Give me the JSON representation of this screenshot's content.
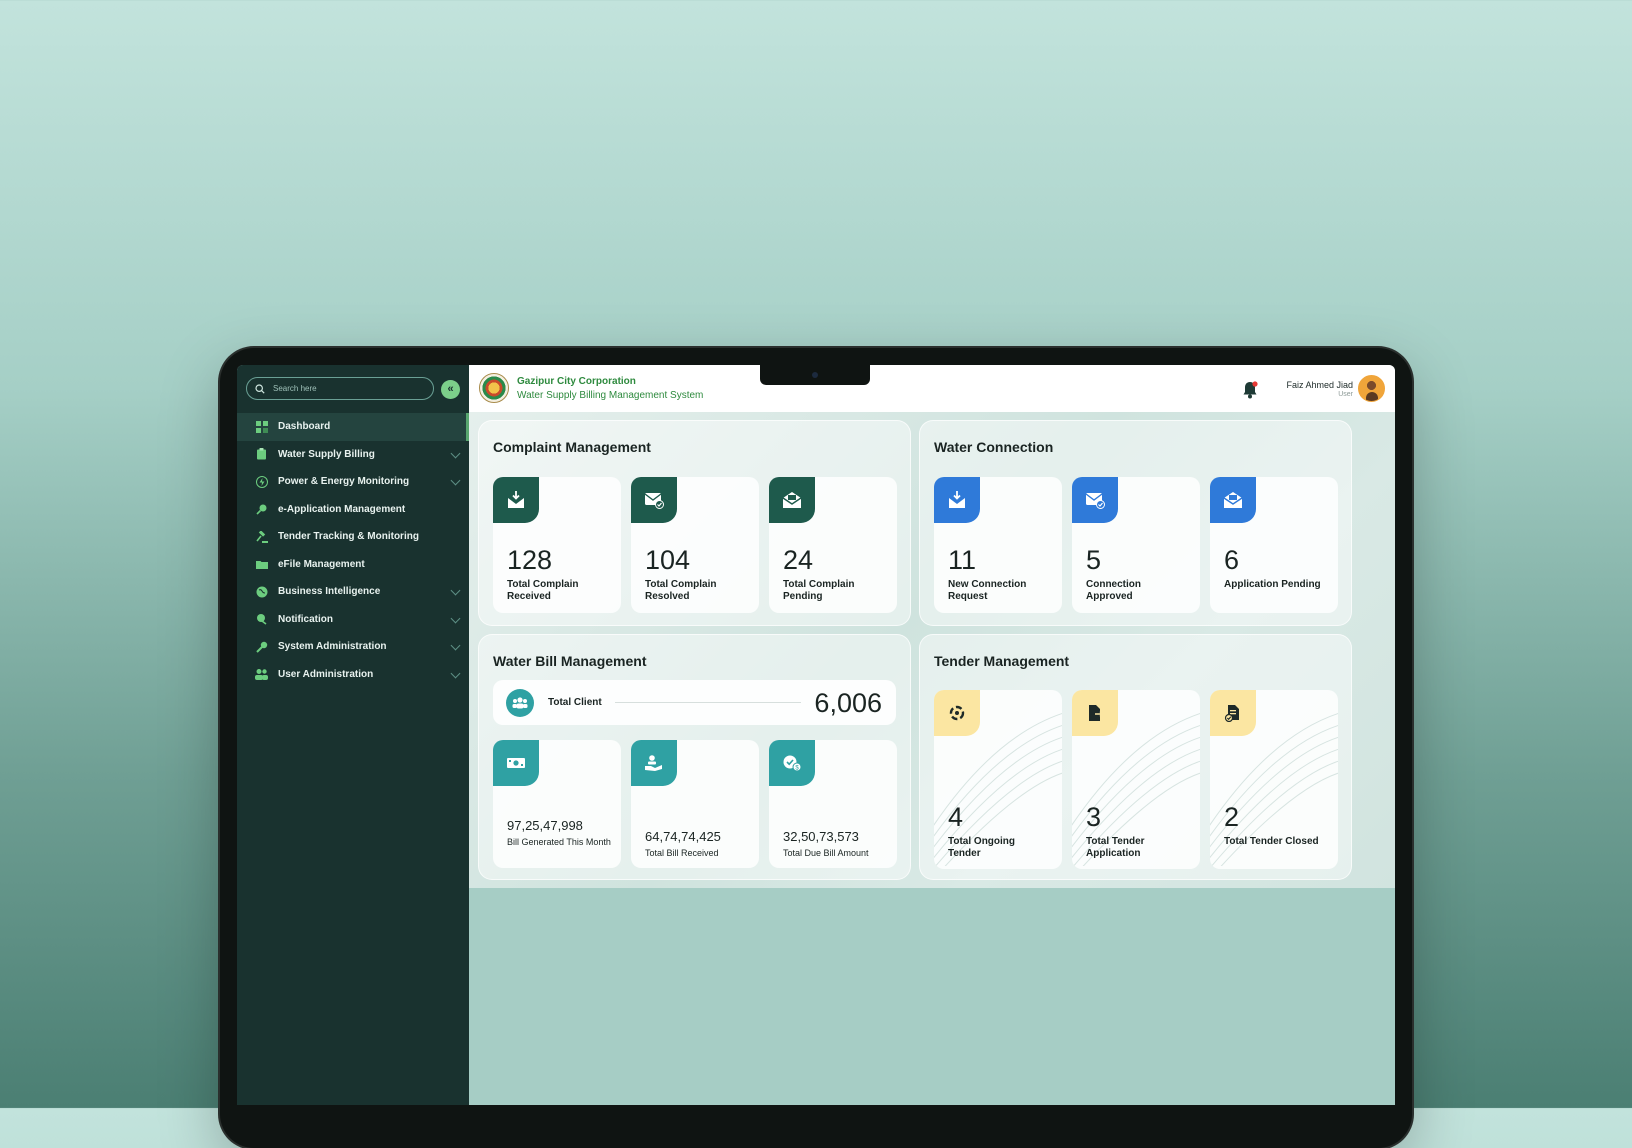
{
  "search": {
    "placeholder": "Search here"
  },
  "sidebar": {
    "collapse_glyph": "«",
    "items": [
      {
        "label": "Dashboard",
        "icon": "dashboard-icon",
        "active": true,
        "has_chevron": false
      },
      {
        "label": "Water Supply Billing",
        "icon": "clipboard-icon",
        "has_chevron": true
      },
      {
        "label": "Power & Energy Monitoring",
        "icon": "lightning-icon",
        "has_chevron": true
      },
      {
        "label": "e-Application Management",
        "icon": "search-doc-icon",
        "has_chevron": false
      },
      {
        "label": "Tender Tracking & Monitoring",
        "icon": "gavel-icon",
        "has_chevron": false
      },
      {
        "label": "eFile Management",
        "icon": "folder-icon",
        "has_chevron": false
      },
      {
        "label": "Business Intelligence",
        "icon": "globe-icon",
        "has_chevron": true
      },
      {
        "label": "Notification",
        "icon": "megaphone-icon",
        "has_chevron": true
      },
      {
        "label": "System Administration",
        "icon": "wrench-icon",
        "has_chevron": true
      },
      {
        "label": "User Administration",
        "icon": "users-icon",
        "has_chevron": true
      }
    ]
  },
  "header": {
    "org_name": "Gazipur City Corporation",
    "system_name": "Water Supply Billing Management System",
    "user_name": "Faiz Ahmed Jiad",
    "user_role": "User"
  },
  "complaint": {
    "title": "Complaint Management",
    "cards": [
      {
        "value": "128",
        "label": "Total Complain Received",
        "icon": "inbox-download-icon"
      },
      {
        "value": "104",
        "label": "Total Complain Resolved",
        "icon": "mail-check-icon"
      },
      {
        "value": "24",
        "label": "Total Complain Pending",
        "icon": "mail-open-icon"
      }
    ]
  },
  "water_connection": {
    "title": "Water Connection",
    "cards": [
      {
        "value": "11",
        "label": "New Connection Request",
        "icon": "inbox-download-icon"
      },
      {
        "value": "5",
        "label": "Connection Approved",
        "icon": "mail-check-icon"
      },
      {
        "value": "6",
        "label": "Application Pending",
        "icon": "mail-open-icon"
      }
    ]
  },
  "water_bill": {
    "title": "Water Bill Management",
    "total_client_label": "Total Client",
    "total_client_value": "6,006",
    "cards": [
      {
        "value": "97,25,47,998",
        "label": "Bill Generated This Month",
        "icon": "cash-icon"
      },
      {
        "value": "64,74,74,425",
        "label": "Total Bill Received",
        "icon": "hand-receive-icon"
      },
      {
        "value": "32,50,73,573",
        "label": "Total Due Bill Amount",
        "icon": "due-icon"
      }
    ]
  },
  "tender": {
    "title": "Tender Management",
    "cards": [
      {
        "value": "4",
        "label": "Total Ongoing Tender",
        "icon": "cycle-icon"
      },
      {
        "value": "3",
        "label": "Total Tender Application",
        "icon": "doc-arrow-icon"
      },
      {
        "value": "2",
        "label": "Total Tender Closed",
        "icon": "doc-check-icon"
      }
    ]
  },
  "colors": {
    "sidebar_bg": "#19322f",
    "accent_green": "#6ccd7f",
    "complaint_icon": "#1e5a4c",
    "connection_icon": "#2f7ad9",
    "bill_icon": "#2fa1a3",
    "tender_icon": "#fbe6a2",
    "notification_dot": "#e53935"
  }
}
